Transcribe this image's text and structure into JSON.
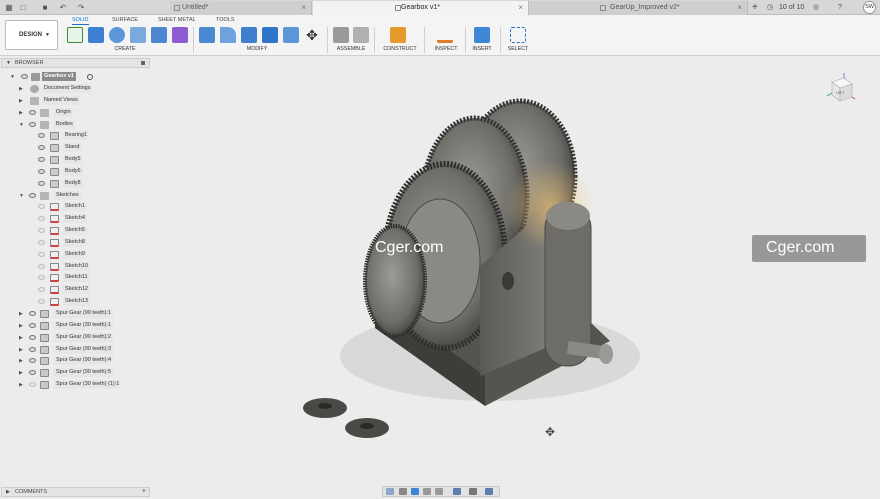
{
  "titlebar": {
    "tabs": [
      {
        "label": "Untitled*",
        "active": false
      },
      {
        "label": "Gearbox v1*",
        "active": true
      },
      {
        "label": "GearUp_Improved v2*",
        "active": false
      }
    ],
    "job_count": "10 of 10",
    "user_initials": "SW",
    "icons": [
      "grid-icon",
      "file-icon",
      "save-icon",
      "undo-icon",
      "redo-icon",
      "plus-icon",
      "clock-icon",
      "bell-icon",
      "help-icon"
    ]
  },
  "toolbar": {
    "workspace": "DESIGN",
    "workspace_tabs": [
      "SOLID",
      "SURFACE",
      "SHEET METAL",
      "TOOLS"
    ],
    "active_tab": "SOLID",
    "groups": [
      "CREATE",
      "MODIFY",
      "ASSEMBLE",
      "CONSTRUCT",
      "INSPECT",
      "INSERT",
      "SELECT"
    ],
    "accent": "#1a73c9"
  },
  "browser": {
    "header": "BROWSER",
    "root": "Gearbox v1",
    "items": [
      {
        "label": "Document Settings",
        "level": 1
      },
      {
        "label": "Named Views",
        "level": 1
      },
      {
        "label": "Origin",
        "level": 1
      },
      {
        "label": "Bodies",
        "level": 1,
        "expanded": true
      },
      {
        "label": "Bearing1",
        "level": 2
      },
      {
        "label": "Stand",
        "level": 2
      },
      {
        "label": "Body5",
        "level": 2
      },
      {
        "label": "Body6",
        "level": 2
      },
      {
        "label": "Body8",
        "level": 2
      },
      {
        "label": "Sketches",
        "level": 1,
        "expanded": true
      },
      {
        "label": "Sketch1",
        "level": 2
      },
      {
        "label": "Sketch4",
        "level": 2
      },
      {
        "label": "Sketch5",
        "level": 2
      },
      {
        "label": "Sketch8",
        "level": 2
      },
      {
        "label": "Sketch9",
        "level": 2
      },
      {
        "label": "Sketch10",
        "level": 2
      },
      {
        "label": "Sketch11",
        "level": 2
      },
      {
        "label": "Sketch12",
        "level": 2
      },
      {
        "label": "Sketch13",
        "level": 2
      },
      {
        "label": "Spur Gear (90 teeth):1",
        "level": 0
      },
      {
        "label": "Spur Gear (30 teeth):1",
        "level": 0
      },
      {
        "label": "Spur Gear (90 teeth):2",
        "level": 0
      },
      {
        "label": "Spur Gear (90 teeth):3",
        "level": 0
      },
      {
        "label": "Spur Gear (90 teeth):4",
        "level": 0
      },
      {
        "label": "Spur Gear (90 teeth):5",
        "level": 0
      },
      {
        "label": "Spur Gear (30 teeth) (1):1",
        "level": 0
      }
    ]
  },
  "comments": {
    "label": "COMMENTS"
  },
  "watermarks": [
    "Cger.com",
    "Cger.com"
  ],
  "viewcube": {
    "face": "LEFT"
  }
}
